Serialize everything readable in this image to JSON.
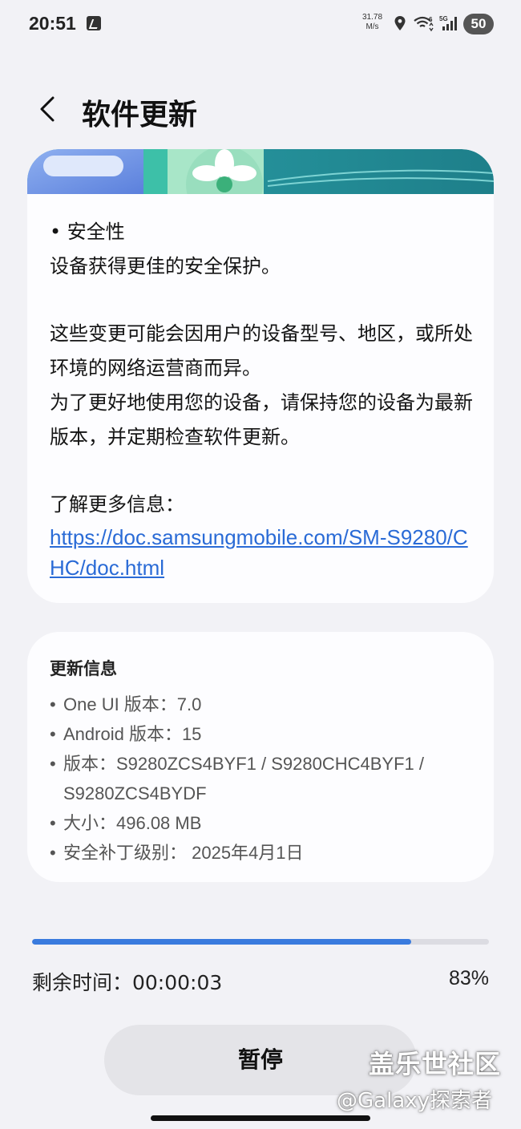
{
  "status_bar": {
    "time": "20:51",
    "speed_value": "31.78",
    "speed_unit": "M/s",
    "network_5g": "5G",
    "wifi_badge": "6",
    "battery": "50"
  },
  "header": {
    "title": "软件更新"
  },
  "release_notes": {
    "lines": [
      "• 安全性",
      "设备获得更佳的安全保护。",
      "",
      "这些变更可能会因用户的设备型号、地区，或所处环境的网络运营商而异。",
      "为了更好地使用您的设备，请保持您的设备为最新版本，并定期检查软件更新。",
      "",
      "了解更多信息："
    ],
    "link": "https://doc.samsungmobile.com/SM-S9280/CHC/doc.html"
  },
  "update_info": {
    "title": "更新信息",
    "items": [
      "One UI 版本：7.0",
      "Android 版本：15",
      "版本：S9280ZCS4BYF1 / S9280CHC4BYF1 / S9280ZCS4BYDF",
      "大小：496.08 MB",
      "安全补丁级别： 2025年4月1日"
    ]
  },
  "progress": {
    "remaining_label": "剩余时间：00:00:03",
    "percent_label": "83%",
    "percent": 83
  },
  "actions": {
    "pause_label": "暂停"
  },
  "watermark": {
    "line1": "盖乐世社区",
    "line2": "@Galaxy探索者"
  },
  "colors": {
    "accent": "#3a7bde",
    "link": "#2a6bd6",
    "background": "#f2f2f6",
    "card": "#fdfdff"
  }
}
